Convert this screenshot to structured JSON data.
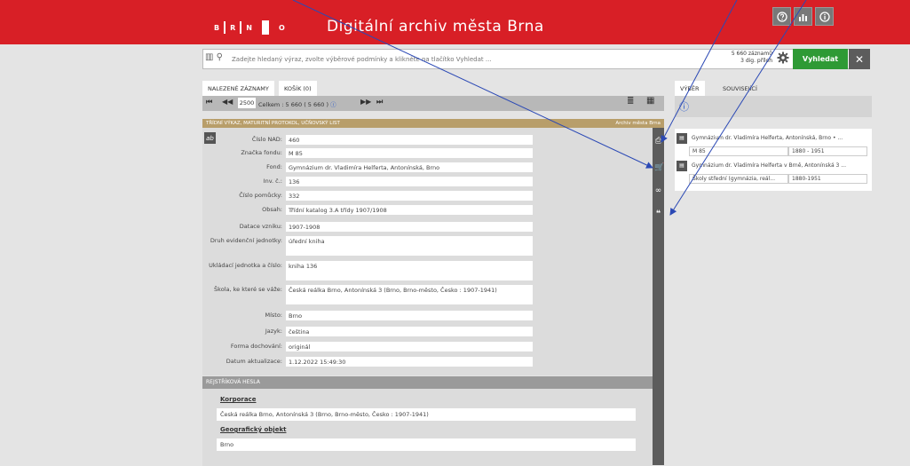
{
  "header": {
    "logo_letters": [
      "B",
      "R",
      "N",
      "O"
    ],
    "title": "Digitální archiv města Brna"
  },
  "search": {
    "placeholder": "Zadejte hledaný výraz, zvolte výběrové podmínky a klikněte na tlačítko Vyhledat ...",
    "count_line1": "5 660 záznamů",
    "count_line2": "3 dig. příloh",
    "submit_label": "Vyhledat",
    "close_label": "✕"
  },
  "tabs": {
    "found": "NALEZENÉ ZÁZNAMY",
    "cart": "KOŠÍK (0)",
    "vyber": "VÝBĚR",
    "souvisejici": "SOUVISEJÍCÍ"
  },
  "pager": {
    "current": "2500",
    "total_text": "Celkem : 5 660 ( 5 660 )"
  },
  "record": {
    "type_title": "TŘÍDNÍ VÝKAZ, MATURITNÍ PROTOKOL, UČŇOVSKÝ LIST",
    "archive": "Archiv města Brna",
    "fields": [
      {
        "label": "Číslo NAD:",
        "value": "460"
      },
      {
        "label": "Značka fondu:",
        "value": "M 85"
      },
      {
        "label": "Fond:",
        "value": "Gymnázium dr. Vladimíra Helferta, Antonínská, Brno"
      },
      {
        "label": "Inv. č.:",
        "value": "136"
      },
      {
        "label": "Číslo pomůcky:",
        "value": "332"
      },
      {
        "label": "Obsah:",
        "value": "Třídní katalog 3.A třídy 1907/1908"
      },
      {
        "label": "Datace vzniku:",
        "value": "1907-1908"
      },
      {
        "label": "Druh evidenční jednotky:",
        "value": "úřední kniha"
      },
      {
        "label": "Ukládací jednotka a číslo:",
        "value": "kniha 136"
      },
      {
        "label": "Škola, ke které se váže:",
        "value": "Česká reálka Brno, Antonínská 3 (Brno, Brno-město, Česko : 1907-1941)"
      },
      {
        "label": "Místo:",
        "value": "Brno"
      },
      {
        "label": "Jazyk:",
        "value": "čeština"
      },
      {
        "label": "Forma dochování:",
        "value": "originál"
      },
      {
        "label": "Datum aktualizace:",
        "value": "1.12.2022 15:49:30"
      }
    ]
  },
  "rejstrik": {
    "section_title": "REJSTŘÍKOVÁ HESLA",
    "korporace_h": "Korporace",
    "korporace_v": "Česká reálka Brno, Antonínská 3 (Brno, Brno-město, Česko : 1907-1941)",
    "geo_h": "Geografický objekt",
    "geo_v": "Brno"
  },
  "right": {
    "item1": "Gymnázium dr. Vladimíra Helferta, Antonínská, Brno • ...",
    "item1_code": "M 85",
    "item1_date": "1880 - 1951",
    "item2": "Gymnázium dr. Vladimíra Helferta v Brně, Antonínská 3 ...",
    "item2_type": "Školy střední (gymnázia, reál...",
    "item2_date": "1880-1951"
  }
}
